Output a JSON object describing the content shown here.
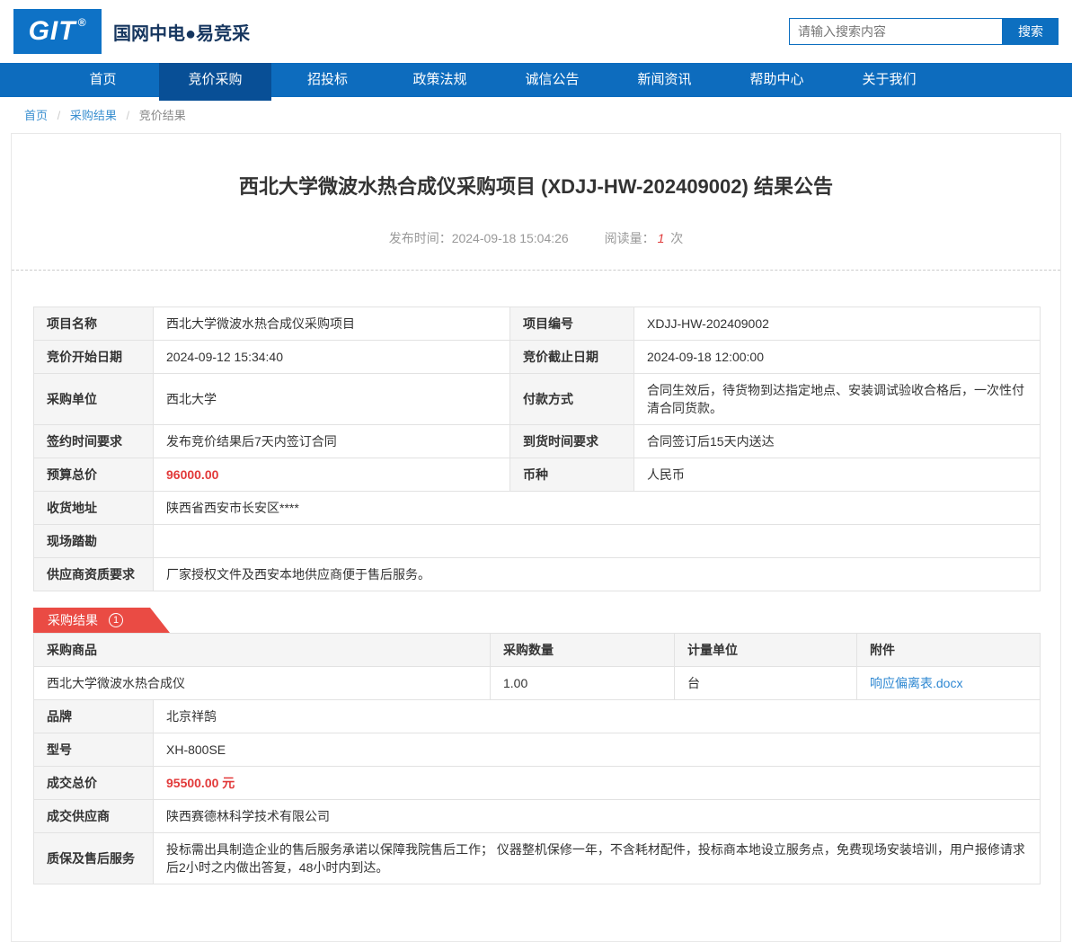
{
  "header": {
    "logo_text": "GIT",
    "logo_reg": "®",
    "brand": "国网中电●易竞采",
    "search": {
      "placeholder": "请输入搜索内容",
      "button_label": "搜索"
    }
  },
  "nav": {
    "items": [
      {
        "label": "首页",
        "active": false
      },
      {
        "label": "竞价采购",
        "active": true
      },
      {
        "label": "招投标",
        "active": false
      },
      {
        "label": "政策法规",
        "active": false
      },
      {
        "label": "诚信公告",
        "active": false
      },
      {
        "label": "新闻资讯",
        "active": false
      },
      {
        "label": "帮助中心",
        "active": false
      },
      {
        "label": "关于我们",
        "active": false
      }
    ]
  },
  "breadcrumb": {
    "separator": "/",
    "items": [
      "首页",
      "采购结果",
      "竞价结果"
    ]
  },
  "article": {
    "title": "西北大学微波水热合成仪采购项目 (XDJJ-HW-202409002) 结果公告",
    "publish_label": "发布时间：",
    "publish_time": "2024-09-18 15:04:26",
    "views_label": "阅读量：",
    "views_count": "1",
    "views_unit": "次"
  },
  "info_table": {
    "rows4col": [
      {
        "label1": "项目名称",
        "value1": "西北大学微波水热合成仪采购项目",
        "label2": "项目编号",
        "value2": "XDJJ-HW-202409002"
      },
      {
        "label1": "竞价开始日期",
        "value1": "2024-09-12 15:34:40",
        "label2": "竞价截止日期",
        "value2": "2024-09-18 12:00:00"
      },
      {
        "label1": "采购单位",
        "value1": "西北大学",
        "label2": "付款方式",
        "value2": "合同生效后，待货物到达指定地点、安装调试验收合格后，一次性付清合同货款。"
      },
      {
        "label1": "签约时间要求",
        "value1": "发布竞价结果后7天内签订合同",
        "label2": "到货时间要求",
        "value2": "合同签订后15天内送达"
      },
      {
        "label1": "预算总价",
        "value1": "96000.00",
        "label2": "币种",
        "value2": "人民币"
      }
    ],
    "rows_full": [
      {
        "label": "收货地址",
        "value": "陕西省西安市长安区****"
      },
      {
        "label": "现场踏勘",
        "value": ""
      },
      {
        "label": "供应商资质要求",
        "value": "厂家授权文件及西安本地供应商便于售后服务。"
      }
    ]
  },
  "result_section": {
    "badge_label": "采购结果",
    "badge_count": "1",
    "table": {
      "headers": [
        "采购商品",
        "采购数量",
        "计量单位",
        "附件"
      ],
      "row": {
        "product": "西北大学微波水热合成仪",
        "quantity": "1.00",
        "unit": "台",
        "attachment": "响应偏离表.docx"
      }
    },
    "details": [
      {
        "label": "品牌",
        "value": "北京祥鹄"
      },
      {
        "label": "型号",
        "value": "XH-800SE"
      },
      {
        "label": "成交总价",
        "value": "95500.00 元"
      },
      {
        "label": "成交供应商",
        "value": "陕西赛德林科学技术有限公司"
      },
      {
        "label": "质保及售后服务",
        "value": "投标需出具制造企业的售后服务承诺以保障我院售后工作； 仪器整机保修一年，不含耗材配件，投标商本地设立服务点，免费现场安装培训，用户报修请求后2小时之内做出答复，48小时内到达。"
      }
    ]
  },
  "colors": {
    "nav_blue": "#0d6cbe",
    "nav_active_blue": "#084f96",
    "logo_blue": "#0e72c6",
    "badge_red": "#ea4b44",
    "price_red": "#e23a3a",
    "link_blue": "#2f88d2"
  }
}
